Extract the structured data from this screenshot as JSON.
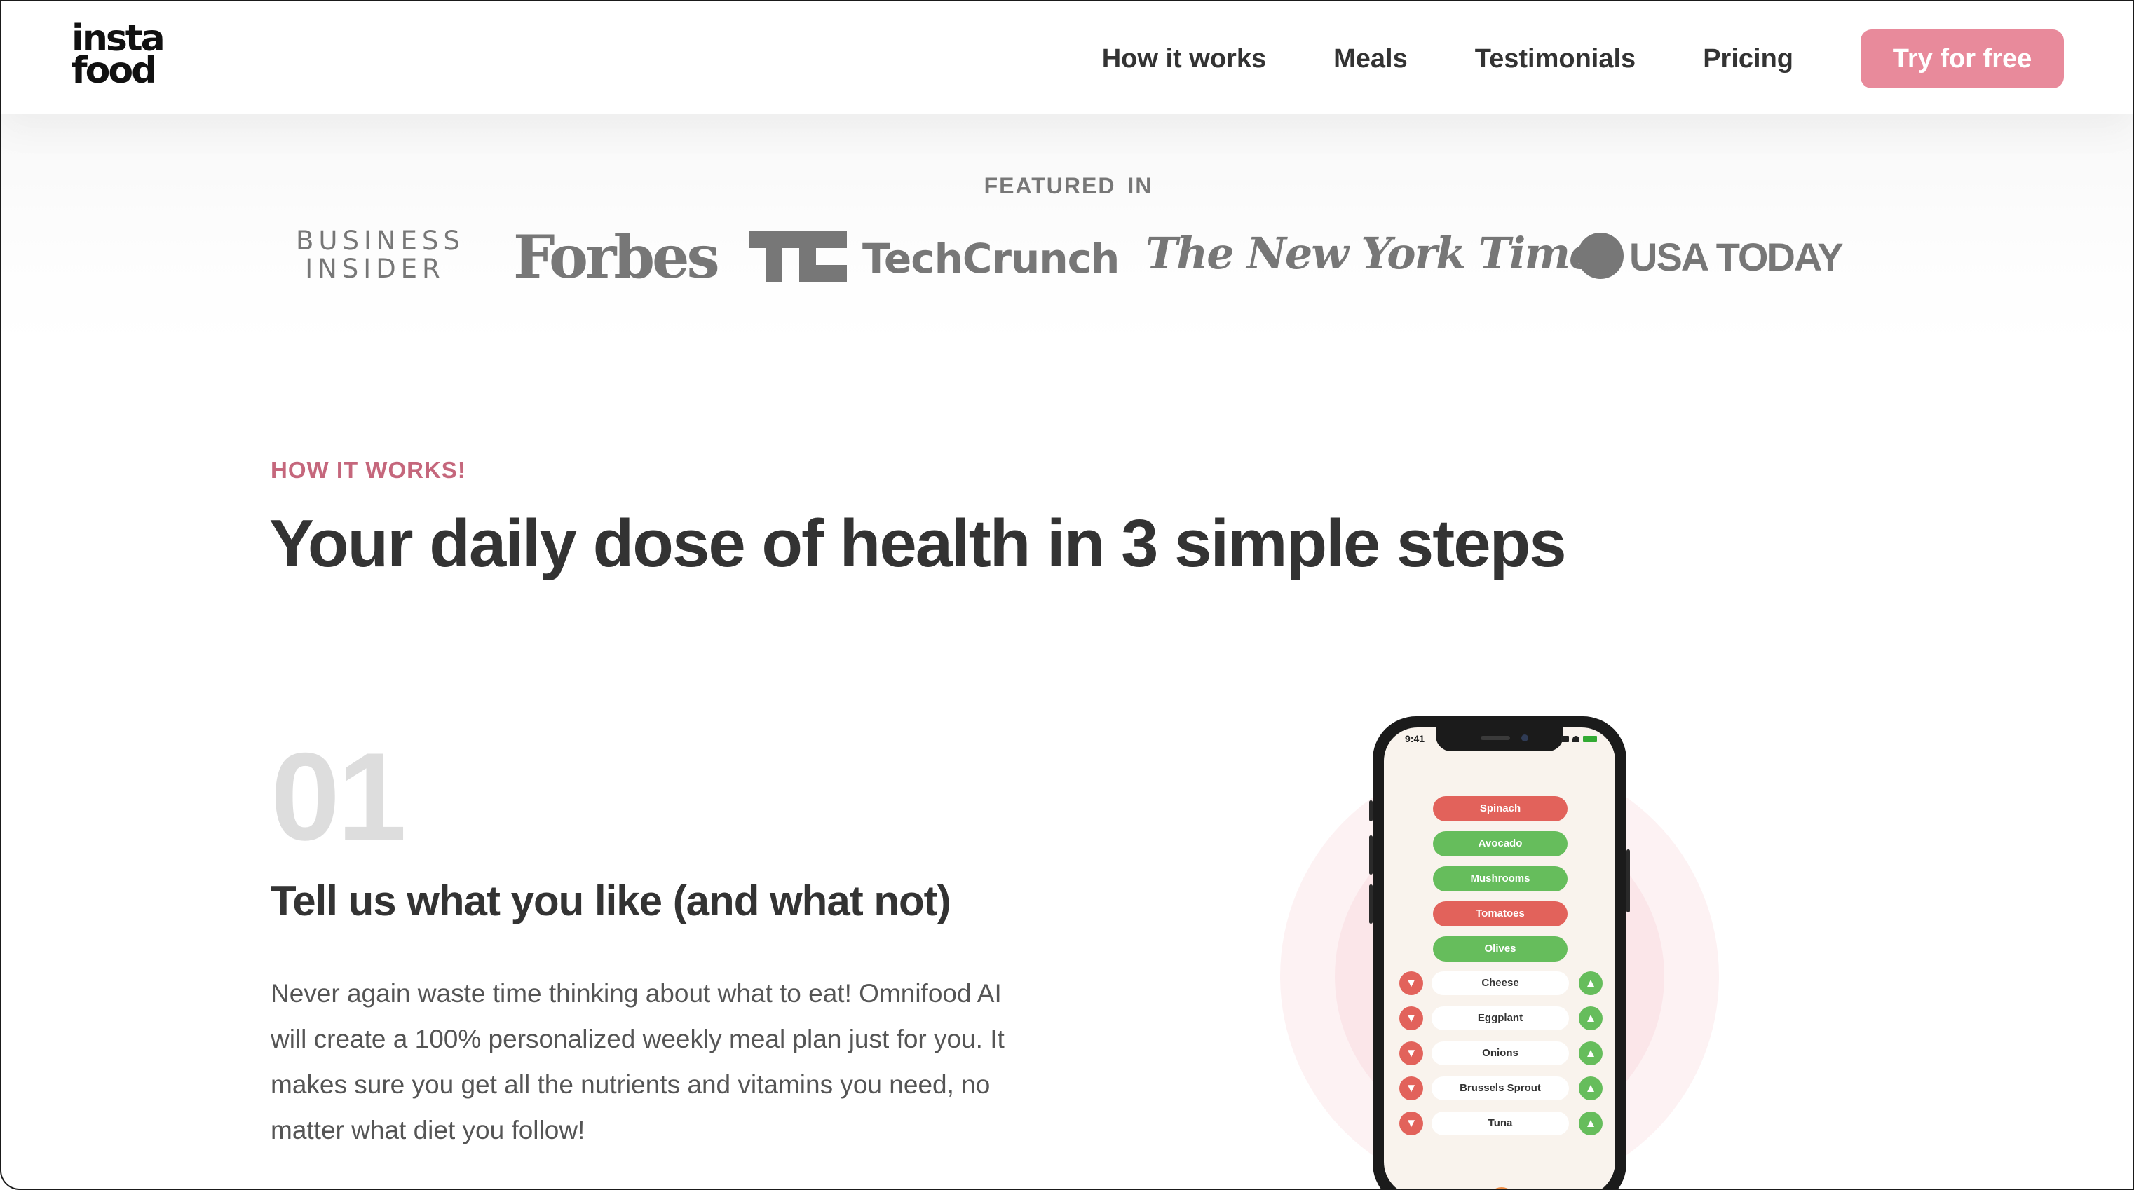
{
  "header": {
    "logo": {
      "line1": "insta",
      "line2": "food"
    },
    "nav": [
      {
        "label": "How it works"
      },
      {
        "label": "Meals"
      },
      {
        "label": "Testimonials"
      },
      {
        "label": "Pricing"
      }
    ],
    "cta_label": "Try for free"
  },
  "featured": {
    "title": "FEATURED IN",
    "logos": {
      "business_insider": {
        "line1": "BUSINESS",
        "line2": "INSIDER"
      },
      "forbes": "Forbes",
      "techcrunch": "TechCrunch",
      "nyt": "The New York Times",
      "usa_today": "USA TODAY"
    }
  },
  "how_it_works": {
    "subheading": "HOW IT WORKS!",
    "heading": "Your daily dose of health in 3 simple steps",
    "step": {
      "number": "01",
      "title": "Tell us what you like (and what not)",
      "description": "Never again waste time thinking about what to eat! Omnifood AI will create a 100% personalized weekly meal plan just for you. It makes sure you get all the nutrients and vitamins you need, no matter what diet you follow!"
    }
  },
  "phone": {
    "status_time": "9:41",
    "pills": [
      {
        "label": "Spinach",
        "color": "#e2625b"
      },
      {
        "label": "Avocado",
        "color": "#66bd5c"
      },
      {
        "label": "Mushrooms",
        "color": "#66bd5c"
      },
      {
        "label": "Tomatoes",
        "color": "#e2625b"
      },
      {
        "label": "Olives",
        "color": "#66bd5c"
      }
    ],
    "rows": [
      {
        "label": "Cheese"
      },
      {
        "label": "Eggplant"
      },
      {
        "label": "Onions"
      },
      {
        "label": "Brussels Sprout"
      },
      {
        "label": "Tuna"
      }
    ]
  },
  "colors": {
    "accent": "#e88a9b",
    "subheading": "#c5677c",
    "dislike": "#e2625b",
    "like": "#66bd5c",
    "text": "#333333",
    "logo_gray": "#777777"
  }
}
